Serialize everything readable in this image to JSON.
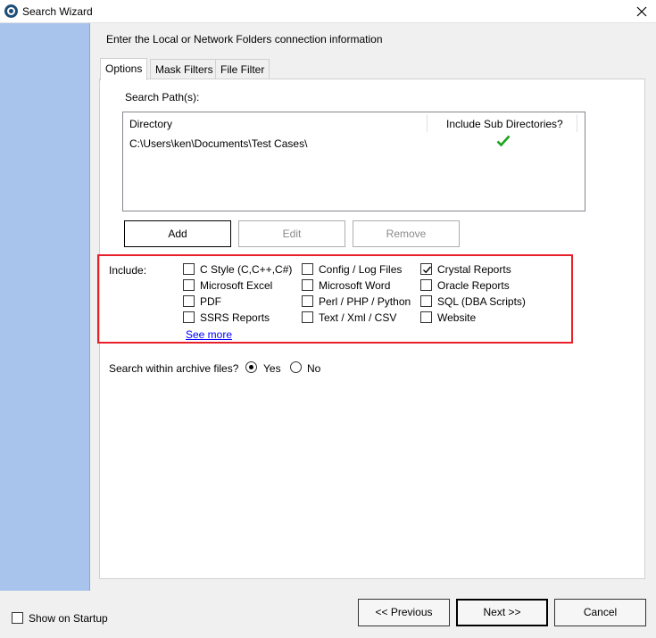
{
  "window": {
    "title": "Search Wizard"
  },
  "heading": "Enter the Local or Network Folders connection information",
  "tabs": [
    {
      "label": "Options",
      "active": true
    },
    {
      "label": "Mask Filters",
      "active": false
    },
    {
      "label": "File Filter",
      "active": false
    }
  ],
  "search_paths": {
    "label": "Search Path(s):",
    "columns": [
      "Directory",
      "Include Sub Directories?"
    ],
    "rows": [
      {
        "directory": "C:\\Users\\ken\\Documents\\Test Cases\\",
        "include_sub": true
      }
    ]
  },
  "path_buttons": {
    "add": "Add",
    "edit": "Edit",
    "remove": "Remove"
  },
  "include": {
    "label": "Include:",
    "options": [
      {
        "label": "C Style (C,C++,C#)",
        "checked": false
      },
      {
        "label": "Config / Log Files",
        "checked": false
      },
      {
        "label": "Crystal Reports",
        "checked": true
      },
      {
        "label": "Microsoft Excel",
        "checked": false
      },
      {
        "label": "Microsoft Word",
        "checked": false
      },
      {
        "label": "Oracle Reports",
        "checked": false
      },
      {
        "label": "PDF",
        "checked": false
      },
      {
        "label": "Perl / PHP / Python",
        "checked": false
      },
      {
        "label": "SQL (DBA Scripts)",
        "checked": false
      },
      {
        "label": "SSRS Reports",
        "checked": false
      },
      {
        "label": "Text / Xml / CSV",
        "checked": false
      },
      {
        "label": "Website",
        "checked": false
      }
    ],
    "see_more": "See more",
    "highlight_color": "#e8202a"
  },
  "archive": {
    "label": "Search within archive files?",
    "yes": "Yes",
    "no": "No",
    "selected": "Yes"
  },
  "footer": {
    "show_on_startup": "Show on Startup",
    "previous": "<< Previous",
    "next": "Next >>",
    "cancel": "Cancel"
  },
  "colors": {
    "left_panel": "#a9c4ec",
    "check_green": "#1aa31a",
    "link": "#0000ff"
  },
  "icons": {
    "app": "search-wizard-app-icon",
    "close": "close-icon",
    "checkmark": "green-checkmark-icon"
  }
}
